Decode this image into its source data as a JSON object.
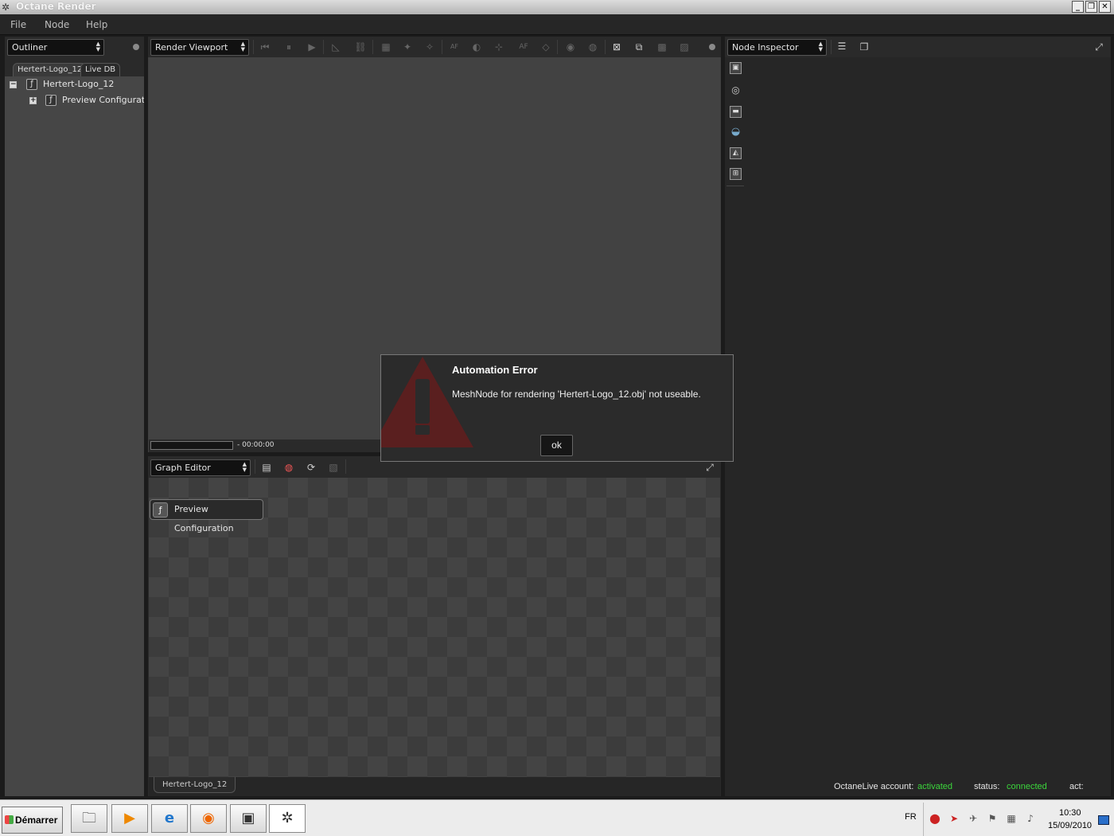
{
  "window": {
    "title": "Octane Render"
  },
  "menu": {
    "items": [
      "File",
      "Node",
      "Help"
    ]
  },
  "outliner": {
    "combo_label": "Outliner",
    "tabs": [
      "Hertert-Logo_12",
      "Live DB"
    ],
    "tree": [
      {
        "label": "Hertert-Logo_12",
        "expander": "−"
      },
      {
        "label": "Preview Configuration",
        "expander": "+"
      }
    ]
  },
  "viewport": {
    "combo_label": "Render Viewport",
    "time": "- 00:00:00",
    "progress": 0
  },
  "graph_editor": {
    "combo_label": "Graph Editor",
    "node_label": "Preview Configuration",
    "bottom_tab": "Hertert-Logo_12"
  },
  "inspector": {
    "combo_label": "Node Inspector",
    "account_label": "OctaneLive account:",
    "account_value": "activated",
    "status_label": "status:",
    "status_value": "connected",
    "act_label": "act:"
  },
  "dialog": {
    "title": "Automation Error",
    "message": "MeshNode for rendering 'Hertert-Logo_12.obj' not useable.",
    "ok_label": "ok"
  },
  "taskbar": {
    "start_label": "Démarrer",
    "lang": "FR",
    "time": "10:30",
    "date": "15/09/2010"
  },
  "colors": {
    "status_green": "#3cd63c",
    "warning_red": "#5a1f1f",
    "panel_bg": "#262626"
  }
}
